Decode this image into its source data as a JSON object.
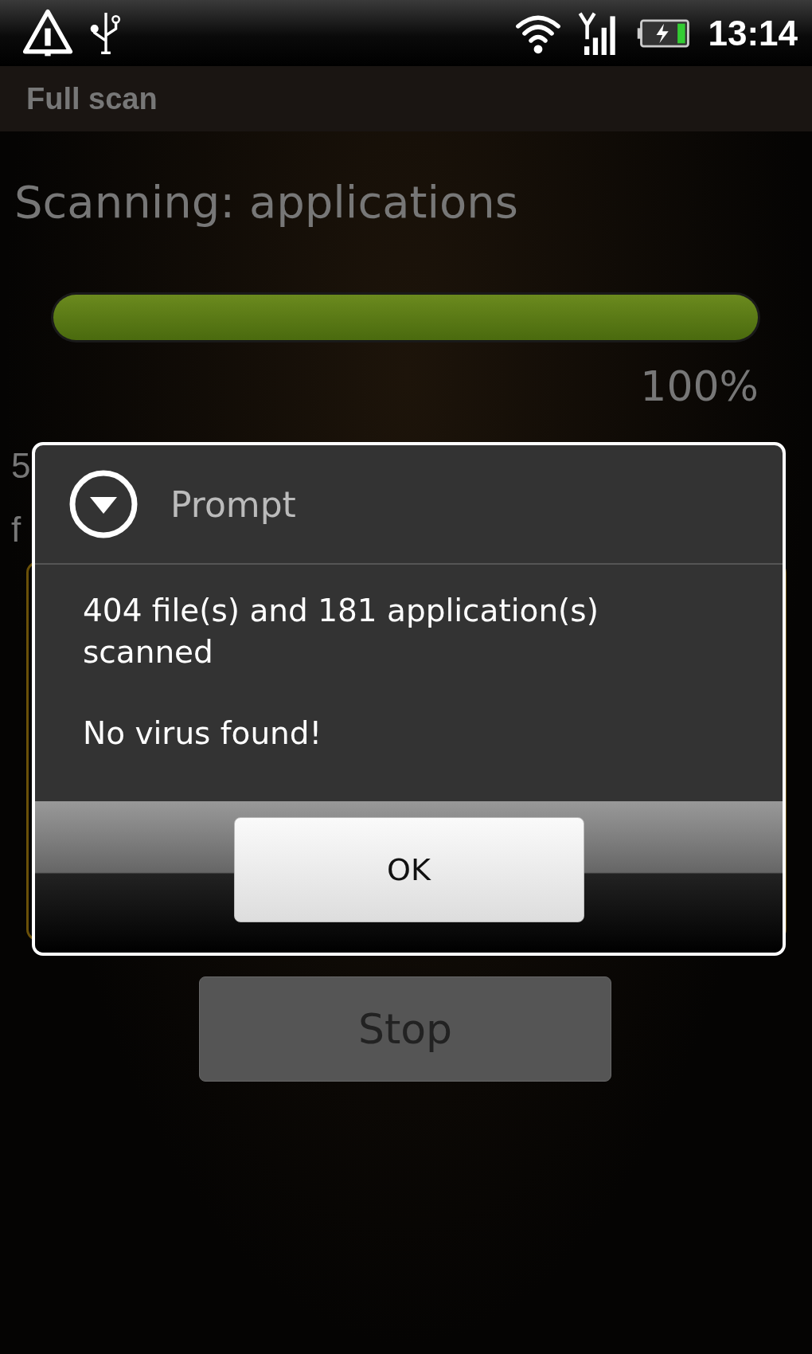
{
  "status_bar": {
    "time": "13:14"
  },
  "title_bar": {
    "title": "Full scan"
  },
  "scan": {
    "heading": "Scanning: applications",
    "progress": {
      "level": 1.0,
      "reading": "100%"
    },
    "hidden_lines": [
      "5",
      "f"
    ],
    "stop_button": "Stop"
  },
  "dialog": {
    "title": "Prompt",
    "message": "404 file(s) and 181 application(s) scanned",
    "result": "No virus found!",
    "buttons": [
      "OK"
    ]
  }
}
